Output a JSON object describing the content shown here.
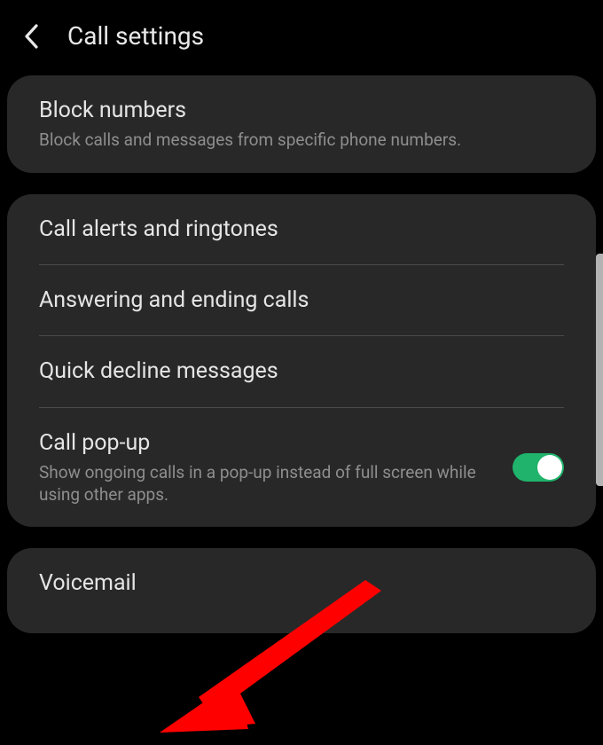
{
  "header": {
    "title": "Call settings"
  },
  "group1": {
    "block_numbers": {
      "title": "Block numbers",
      "sub": "Block calls and messages from specific phone numbers."
    }
  },
  "group2": {
    "call_alerts": {
      "title": "Call alerts and ringtones"
    },
    "answering": {
      "title": "Answering and ending calls"
    },
    "quick_decline": {
      "title": "Quick decline messages"
    },
    "call_popup": {
      "title": "Call pop-up",
      "sub": "Show ongoing calls in a pop-up instead of full screen while using other apps.",
      "enabled": true
    }
  },
  "group3": {
    "voicemail": {
      "title": "Voicemail"
    }
  },
  "colors": {
    "toggle_on": "#1fb36b",
    "arrow": "#ff0000"
  }
}
